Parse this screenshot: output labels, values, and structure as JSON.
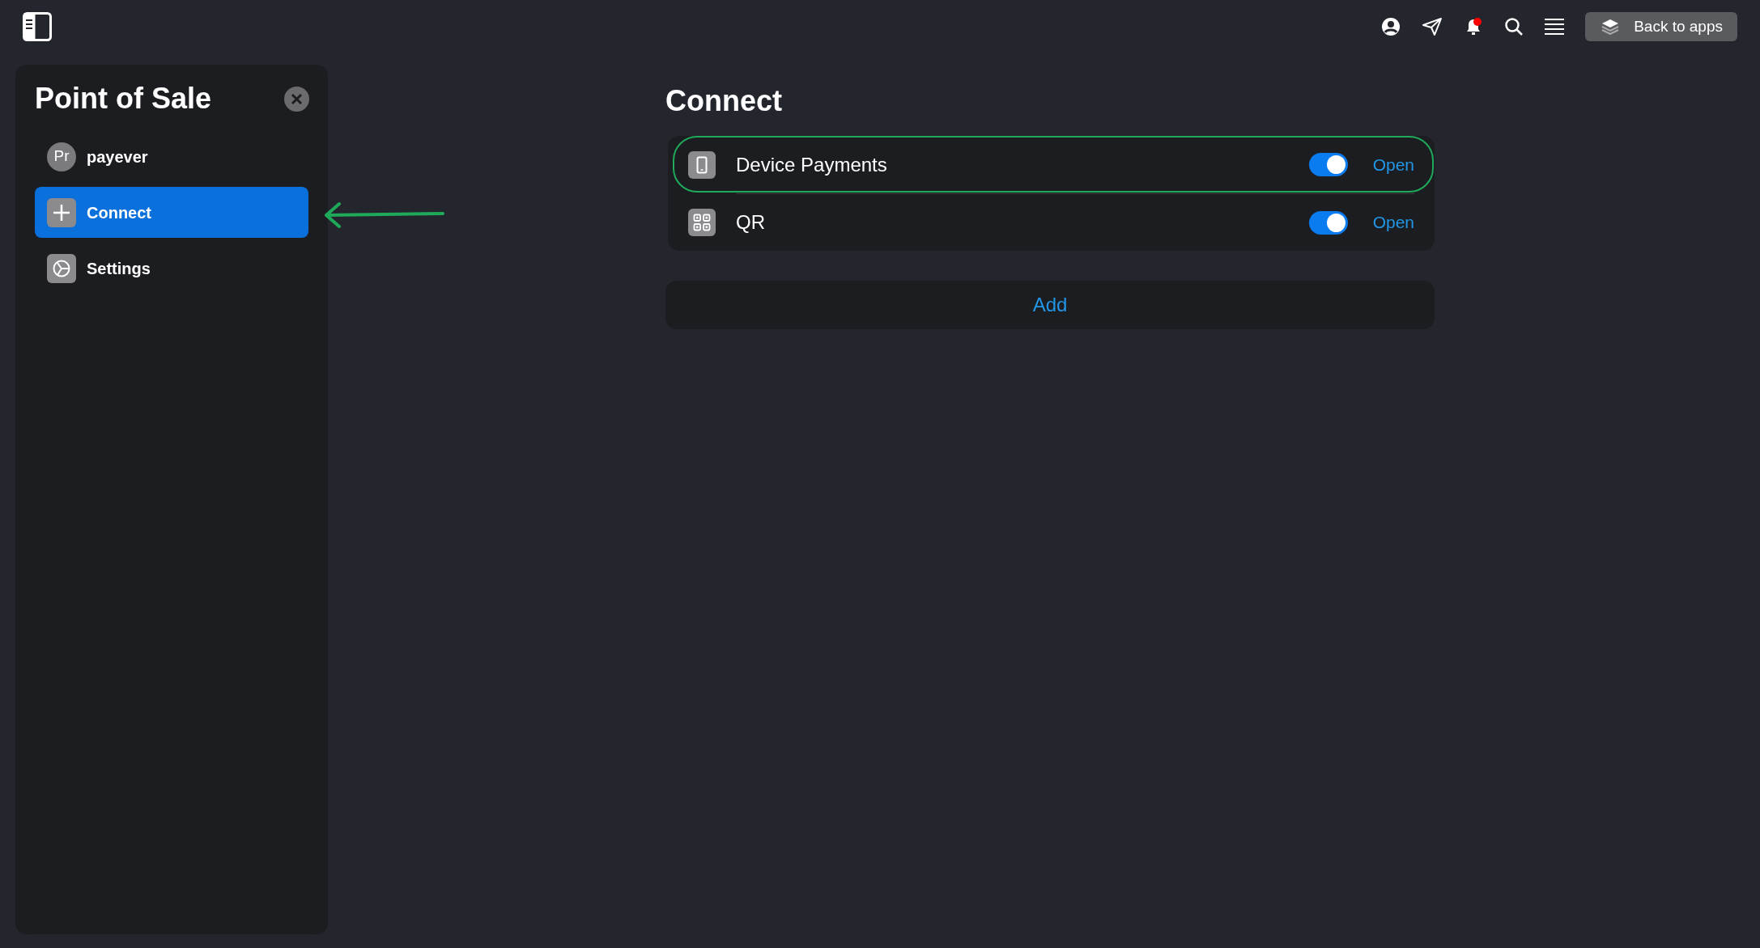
{
  "header": {
    "back_button": "Back to apps"
  },
  "sidebar": {
    "title": "Point of Sale",
    "items": [
      {
        "kind": "avatar",
        "initials": "Pr",
        "label": "payever",
        "selected": false
      },
      {
        "kind": "connect",
        "label": "Connect",
        "selected": true
      },
      {
        "kind": "settings",
        "label": "Settings",
        "selected": false
      }
    ]
  },
  "content": {
    "title": "Connect",
    "integrations": [
      {
        "kind": "device",
        "name": "Device Payments",
        "on": true,
        "highlighted": true,
        "action": "Open"
      },
      {
        "kind": "qr",
        "name": "QR",
        "on": true,
        "highlighted": false,
        "action": "Open"
      }
    ],
    "add_button": "Add"
  }
}
